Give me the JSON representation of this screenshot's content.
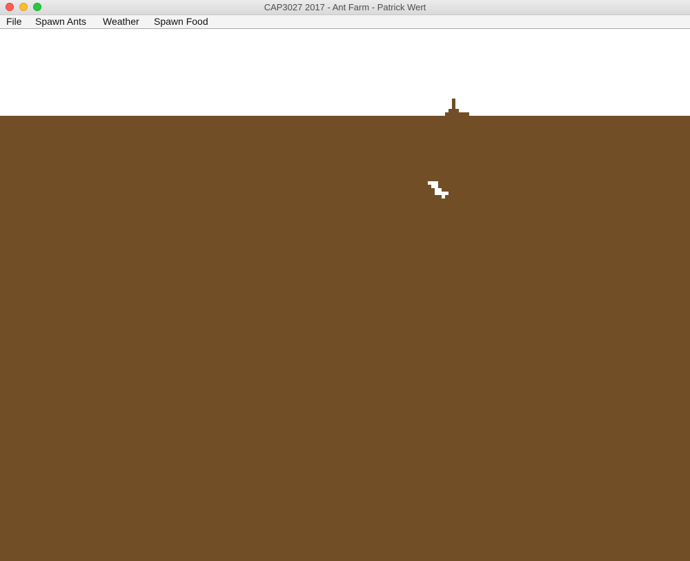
{
  "window": {
    "title": "CAP3027 2017 - Ant Farm - Patrick Wert"
  },
  "menubar": {
    "items": [
      {
        "label": "File"
      },
      {
        "label": "Spawn Ants"
      },
      {
        "label": "Weather"
      },
      {
        "label": "Spawn Food"
      }
    ]
  },
  "colors": {
    "dirt": "#724e27",
    "sky": "#ffffff",
    "tunnel": "#ffffff"
  }
}
